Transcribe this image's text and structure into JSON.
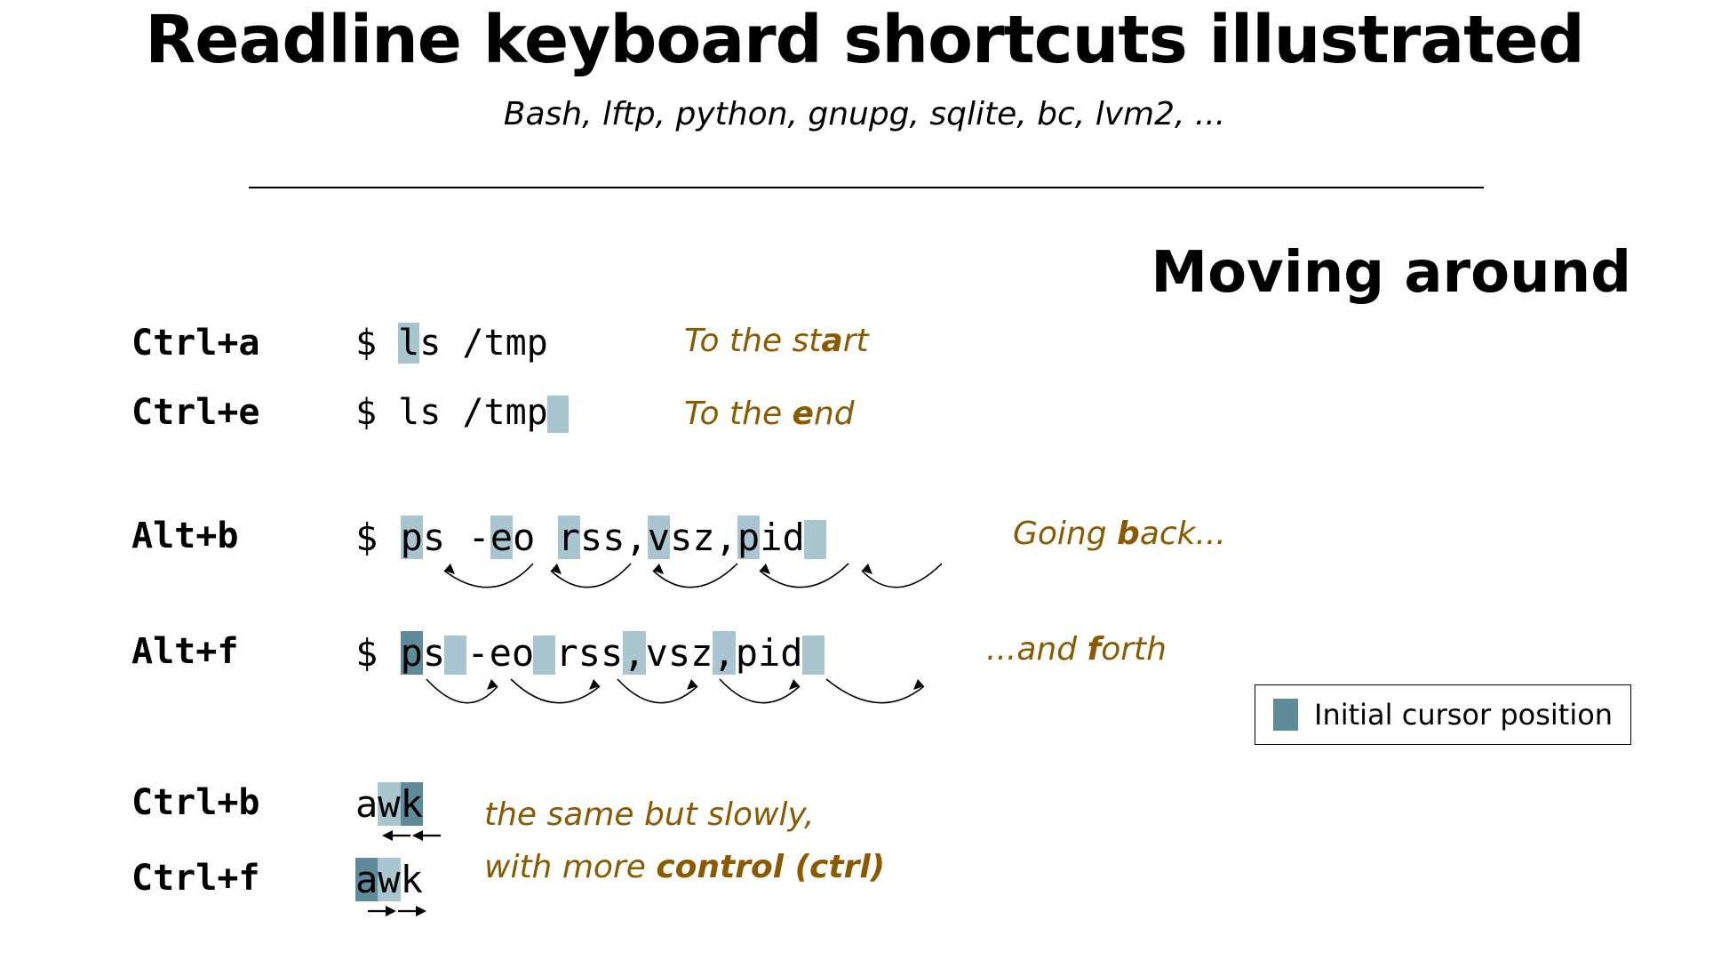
{
  "title": "Readline keyboard shortcuts illustrated",
  "subtitle": "Bash, lftp, python, gnupg, sqlite, bc, lvm2, ...",
  "section_heading": "Moving around",
  "legend_label": "Initial cursor position",
  "colors": {
    "annotation": "#8b5a00",
    "cursor_light": "#a9c5cf",
    "cursor_dark": "#5f8a9a"
  },
  "shortcuts": [
    {
      "key": "Ctrl+a",
      "command": "$ ls /tmp",
      "desc_pre": "To the st",
      "desc_em": "a",
      "desc_post": "rt"
    },
    {
      "key": "Ctrl+e",
      "command": "$ ls /tmp",
      "desc_pre": "To the ",
      "desc_em": "e",
      "desc_post": "nd"
    },
    {
      "key": "Alt+b",
      "command": "$ ps -eo rss,vsz,pid",
      "desc_pre": "Going ",
      "desc_em": "b",
      "desc_post": "ack..."
    },
    {
      "key": "Alt+f",
      "command": "$ ps -eo rss,vsz,pid",
      "desc_pre": "...and ",
      "desc_em": "f",
      "desc_post": "orth"
    },
    {
      "key": "Ctrl+b",
      "command": "awk",
      "desc_pre": "the same but slowly,",
      "desc_em": "",
      "desc_post": ""
    },
    {
      "key": "Ctrl+f",
      "command": "awk",
      "desc_pre": "with more ",
      "desc_em": "control (ctrl)",
      "desc_post": ""
    }
  ]
}
